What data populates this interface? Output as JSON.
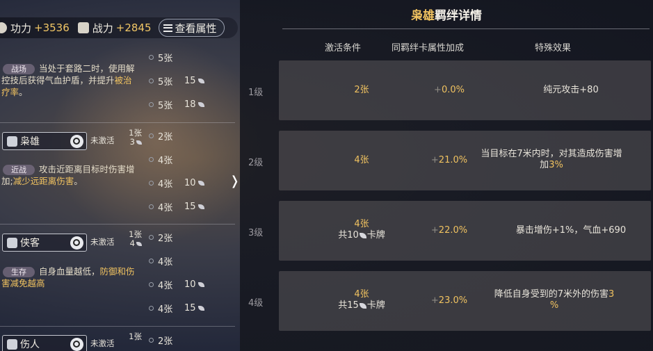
{
  "topbar": {
    "power_label": "功力",
    "power_value": "+3536",
    "combat_label": "战力",
    "combat_value": "+2845",
    "attr_button": "查看属性"
  },
  "left_sections": [
    {
      "tag": "战场",
      "desc_a": "当处于套路二时，使用解控技后获得气血护盾，并提升",
      "desc_hl": "被治疗率",
      "desc_b": "。",
      "tiers": [
        {
          "n": "5张",
          "c": ""
        },
        {
          "n": "5张",
          "c": "15"
        },
        {
          "n": "5张",
          "c": "18"
        }
      ]
    },
    {
      "name": "枭雄",
      "status": "未激活",
      "count_top": "1张",
      "count_bottom": "3",
      "tag": "近战",
      "desc_a": "攻击近距离目标时伤害增加;",
      "desc_hl": "减少远距离伤害",
      "desc_b": "。",
      "tiers": [
        {
          "n": "2张",
          "c": ""
        },
        {
          "n": "4张",
          "c": ""
        },
        {
          "n": "4张",
          "c": "10"
        },
        {
          "n": "4张",
          "c": "15"
        }
      ]
    },
    {
      "name": "侠客",
      "status": "未激活",
      "count_top": "1张",
      "count_bottom": "4",
      "tag": "生存",
      "desc_a": "自身血量越低，",
      "desc_hl": "防御和伤害减免越高",
      "desc_b": "",
      "tiers": [
        {
          "n": "2张",
          "c": ""
        },
        {
          "n": "4张",
          "c": ""
        },
        {
          "n": "4张",
          "c": "10"
        },
        {
          "n": "4张",
          "c": "15"
        }
      ]
    },
    {
      "name": "伤人",
      "status": "未激活",
      "count_top": "1张",
      "tiers": [
        {
          "n": "2张",
          "c": ""
        }
      ]
    }
  ],
  "detail": {
    "title_hl": "枭雄",
    "title_rest": "羁绊详情",
    "col_condition": "激活条件",
    "col_bonus": "同羁绊卡属性加成",
    "col_effect": "特殊效果",
    "rows": [
      {
        "level": "1级",
        "cond": "2张",
        "cond_sub": "",
        "bonus_pre": "+",
        "bonus": "0.0%",
        "effect": "纯元攻击+80",
        "effect_hl": "",
        "effect_tail": ""
      },
      {
        "level": "2级",
        "cond": "4张",
        "cond_sub": "",
        "bonus_pre": "+",
        "bonus": "21.0%",
        "effect": "当目标在7米内时，对其造成伤害增加",
        "effect_hl": "3%",
        "effect_tail": ""
      },
      {
        "level": "3级",
        "cond": "4张",
        "cond_sub_a": "共10",
        "cond_sub_b": "卡牌",
        "bonus_pre": "+",
        "bonus": "22.0%",
        "effect": "暴击增伤+1%，气血+690",
        "effect_hl": "",
        "effect_tail": ""
      },
      {
        "level": "4级",
        "cond": "4张",
        "cond_sub_a": "共15",
        "cond_sub_b": "卡牌",
        "bonus_pre": "+",
        "bonus": "23.0%",
        "effect": "降低自身受到的7米外的伤害",
        "effect_hl": "3",
        "effect_tail": "%"
      }
    ]
  }
}
